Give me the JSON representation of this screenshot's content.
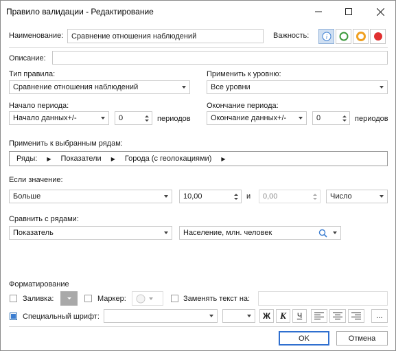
{
  "window": {
    "title": "Правило валидации - Редактирование"
  },
  "name": {
    "label": "Наименование:",
    "value": "Сравнение отношения наблюдений"
  },
  "importance": {
    "label": "Важность:",
    "colors": [
      "#3a7dd1",
      "#3c9a3c",
      "#f0a020",
      "#e03030"
    ]
  },
  "description": {
    "label": "Описание:",
    "value": ""
  },
  "rule_type": {
    "label": "Тип правила:",
    "value": "Сравнение отношения наблюдений"
  },
  "apply_level": {
    "label": "Применить к уровню:",
    "value": "Все уровни"
  },
  "period_start": {
    "label": "Начало периода:",
    "mode": "Начало данных+/-",
    "count": "0",
    "units": "периодов"
  },
  "period_end": {
    "label": "Окончание периода:",
    "mode": "Окончание данных+/-",
    "count": "0",
    "units": "периодов"
  },
  "rows": {
    "label": "Применить к выбранным рядам:",
    "crumbs": [
      "Ряды:",
      "Показатели",
      "Города (с геолокациями)"
    ]
  },
  "if_value": {
    "label": "Если значение:",
    "condition": "Больше",
    "value1": "10,00",
    "and_label": "и",
    "value2": "0,00",
    "type": "Число"
  },
  "compare": {
    "label": "Сравнить с рядами:",
    "series": "Показатель",
    "search": "Население, млн. человек"
  },
  "format": {
    "label": "Форматирование",
    "fill_label": "Заливка:",
    "marker_label": "Маркер:",
    "replace_label": "Заменять текст на:",
    "replace_value": "",
    "font_label": "Специальный шрифт:",
    "font_value": "",
    "size_value": "",
    "bold": "Ж",
    "italic": "К",
    "underline": "Ч",
    "more": "..."
  },
  "buttons": {
    "ok": "OK",
    "cancel": "Отмена"
  }
}
